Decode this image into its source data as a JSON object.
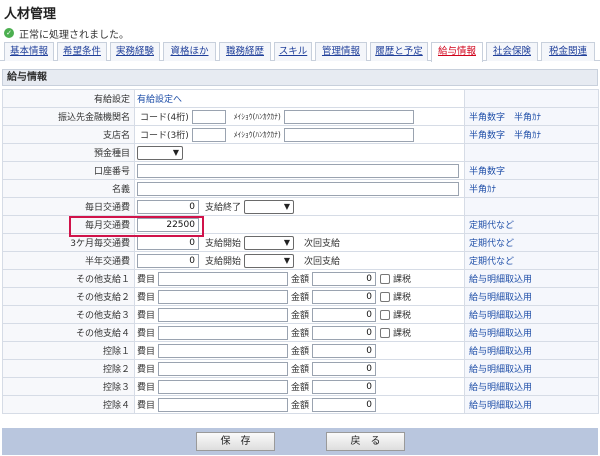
{
  "header": {
    "title": "人材管理"
  },
  "status": {
    "message": "正常に処理されました。",
    "icon": "check-circle-icon"
  },
  "tabs": [
    {
      "label": "基本情報"
    },
    {
      "label": "希望条件"
    },
    {
      "label": "実務経験"
    },
    {
      "label": "資格ほか"
    },
    {
      "label": "職務経歴"
    },
    {
      "label": "スキル"
    },
    {
      "label": "管理情報"
    },
    {
      "label": "履歴と予定"
    },
    {
      "label": "給与情報",
      "active": true
    },
    {
      "label": "社会保険"
    },
    {
      "label": "税金関連"
    }
  ],
  "section": {
    "title": "給与情報"
  },
  "form": {
    "yukyu": {
      "label": "有給設定",
      "link": "有給設定へ"
    },
    "bank": {
      "label": "振込先金融機関名",
      "code_label": "コード(4桁)",
      "kana_label": "ﾒｲｼｮｳ(ﾊﾝｶｸｶﾅ)",
      "note": "半角数字　半角ｶﾅ"
    },
    "branch": {
      "label": "支店名",
      "code_label": "コード(3桁)",
      "kana_label": "ﾒｲｼｮｳ(ﾊﾝｶｸｶﾅ)",
      "note": "半角数字　半角ｶﾅ"
    },
    "deposit": {
      "label": "預金種目"
    },
    "account": {
      "label": "口座番号",
      "note": "半角数字"
    },
    "holder": {
      "label": "名義",
      "note": "半角ｶﾅ"
    },
    "daily": {
      "label": "毎日交通費",
      "value": "0",
      "end_label": "支給終了"
    },
    "monthly": {
      "label": "毎月交通費",
      "value": "22500",
      "note": "定期代など"
    },
    "quarterly": {
      "label": "3ケ月毎交通費",
      "value": "0",
      "start_label": "支給開始",
      "next_label": "次回支給",
      "note": "定期代など"
    },
    "half": {
      "label": "半年交通費",
      "value": "0",
      "start_label": "支給開始",
      "next_label": "次回支給",
      "note": "定期代など"
    },
    "common": {
      "item_label": "費目",
      "amount_label": "金額",
      "tax_label": "課税",
      "zero": "0",
      "note": "給与明細取込用"
    },
    "others": [
      {
        "label": "その他支給１"
      },
      {
        "label": "その他支給２"
      },
      {
        "label": "その他支給３"
      },
      {
        "label": "その他支給４"
      }
    ],
    "deductions": [
      {
        "label": "控除１"
      },
      {
        "label": "控除２"
      },
      {
        "label": "控除３"
      },
      {
        "label": "控除４"
      }
    ]
  },
  "footer": {
    "save": "保　存",
    "back": "戻　る"
  },
  "colors": {
    "tab_active": "#d0021b",
    "link": "#1f4fa8",
    "highlight": "#d0134a",
    "footer_bg": "#b9c6de"
  }
}
